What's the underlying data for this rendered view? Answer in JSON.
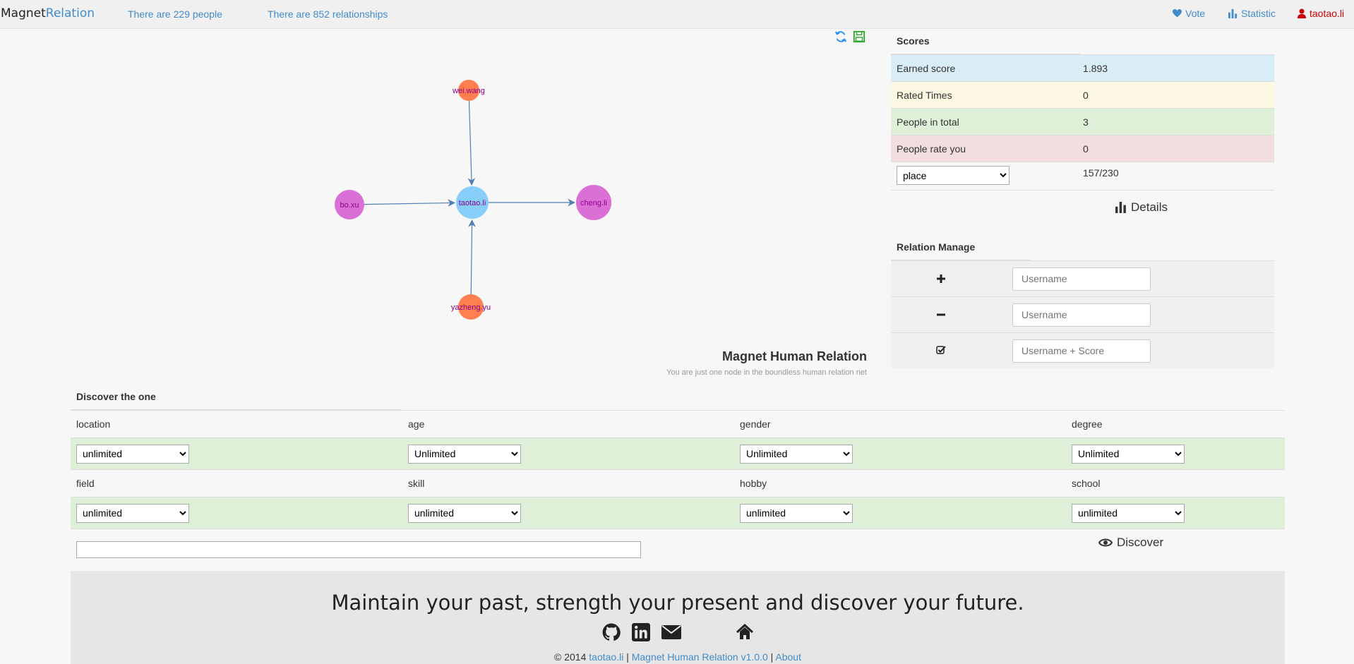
{
  "navbar": {
    "brand_part1": "Magnet",
    "brand_part2": "Relation",
    "people_count": "There are 229 people",
    "relationship_count": "There are 852 relationships",
    "vote": "Vote",
    "statistic": "Statistic",
    "user": "taotao.li"
  },
  "graph": {
    "nodes": [
      {
        "id": "wei.wang",
        "label": "wei.wang",
        "color": "#ff7f50"
      },
      {
        "id": "bo.xu",
        "label": "bo.xu",
        "color": "#da70d6"
      },
      {
        "id": "taotao.li",
        "label": "taotao.li",
        "color": "#87cefa"
      },
      {
        "id": "cheng.li",
        "label": "cheng.li",
        "color": "#da70d6"
      },
      {
        "id": "yazheng.yu",
        "label": "yazheng.yu",
        "color": "#ff7f50"
      }
    ],
    "edges": [
      {
        "from": "wei.wang",
        "to": "taotao.li"
      },
      {
        "from": "bo.xu",
        "to": "taotao.li"
      },
      {
        "from": "taotao.li",
        "to": "cheng.li"
      },
      {
        "from": "yazheng.yu",
        "to": "taotao.li"
      }
    ],
    "tools": [
      "refresh-icon",
      "save-icon"
    ]
  },
  "hero": {
    "title": "Magnet Human Relation",
    "subtitle": "You are just one node in the boundless human relation net"
  },
  "scores": {
    "title": "Scores",
    "rows": [
      {
        "label": "Earned score",
        "value": "1.893"
      },
      {
        "label": "Rated Times",
        "value": "0"
      },
      {
        "label": "People in total",
        "value": "3"
      },
      {
        "label": "People rate you",
        "value": "0"
      }
    ],
    "place_select": "place",
    "place_value": "157/230",
    "details_label": "Details"
  },
  "relation": {
    "title": "Relation Manage",
    "add_placeholder": "Username",
    "remove_placeholder": "Username",
    "rate_placeholder": "Username + Score"
  },
  "discover": {
    "title": "Discover the one",
    "row1_labels": [
      "location",
      "age",
      "gender",
      "degree"
    ],
    "row1_values": [
      "unlimited",
      "Unlimited",
      "Unlimited",
      "Unlimited"
    ],
    "row2_labels": [
      "field",
      "skill",
      "hobby",
      "school"
    ],
    "row2_values": [
      "unlimited",
      "unlimited",
      "unlimited",
      "unlimited"
    ],
    "button_label": "Discover"
  },
  "footer": {
    "slogan": "Maintain your past, strength your present and discover your future.",
    "copyright_prefix": "© 2014",
    "author_link": "taotao.li",
    "separator": "|",
    "project_link": "Magnet Human Relation v1.0.0",
    "about_link": "About",
    "social_icons": [
      "github-icon",
      "linkedin-icon",
      "mail-icon",
      "home-icon"
    ]
  },
  "colors": {
    "link": "#428bca",
    "user": "#cc0000",
    "edge": "#4f7fb3",
    "node_label": "#8b008b"
  }
}
